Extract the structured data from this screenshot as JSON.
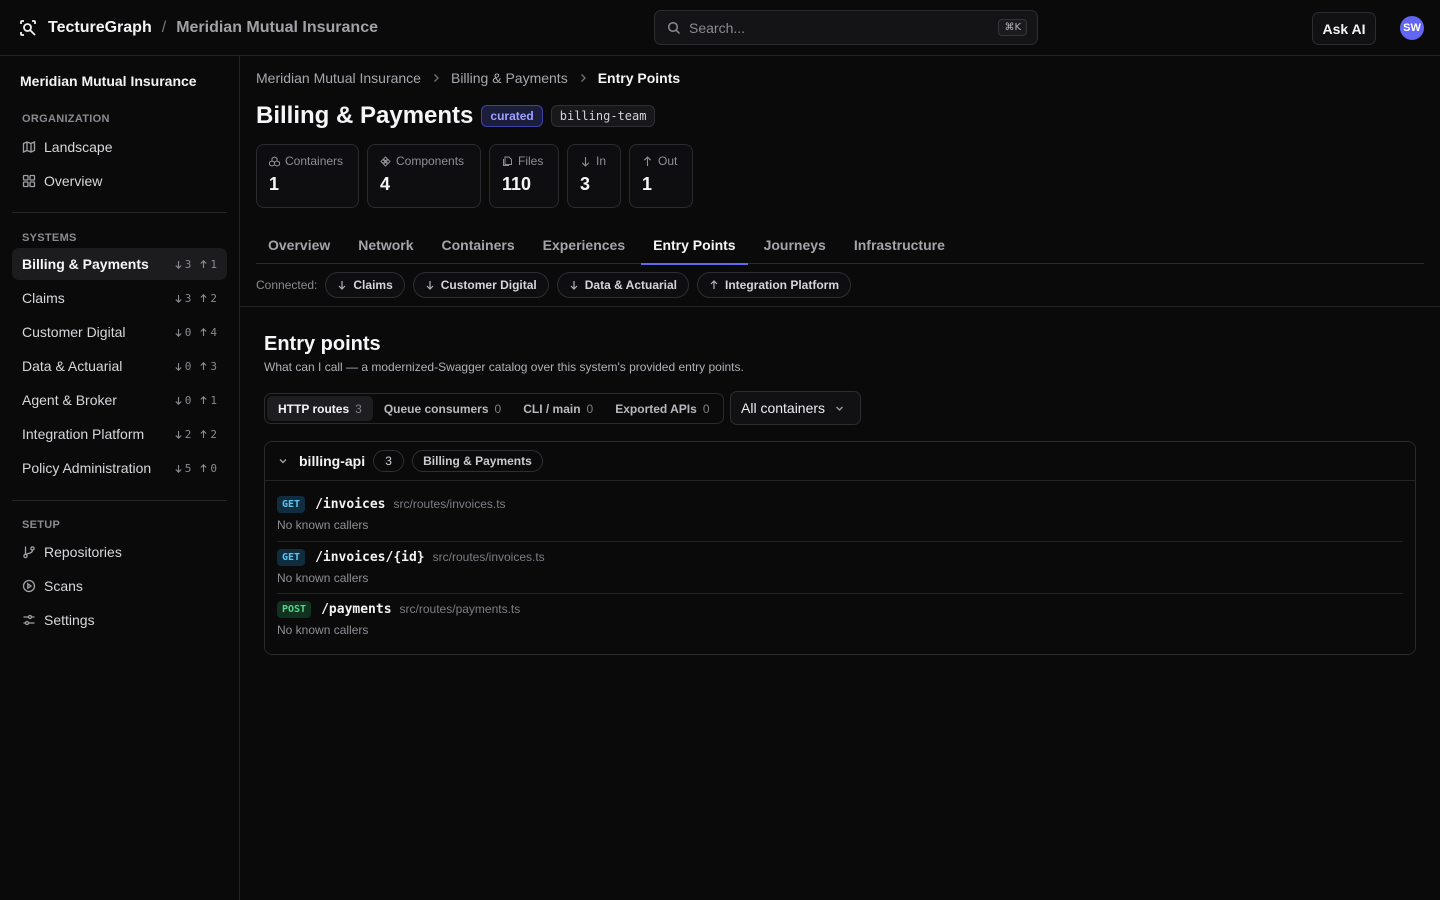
{
  "app": {
    "brand": "TectureGraph",
    "separator": "/",
    "org": "Meridian Mutual Insurance",
    "search_placeholder": "Search...",
    "search_shortcut": "⌘K",
    "ask_ai": "Ask AI",
    "avatar_initials": "SW",
    "accent_color": "#6366f1"
  },
  "sidebar": {
    "org_name": "Meridian Mutual Insurance",
    "organization_label": "ORGANIZATION",
    "organization_items": [
      {
        "label": "Landscape",
        "icon": "map-icon"
      },
      {
        "label": "Overview",
        "icon": "grid-icon"
      }
    ],
    "systems_label": "SYSTEMS",
    "systems": [
      {
        "label": "Billing & Payments",
        "in": "3",
        "out": "1",
        "active": true
      },
      {
        "label": "Claims",
        "in": "3",
        "out": "2"
      },
      {
        "label": "Customer Digital",
        "in": "0",
        "out": "4"
      },
      {
        "label": "Data & Actuarial",
        "in": "0",
        "out": "3"
      },
      {
        "label": "Agent & Broker",
        "in": "0",
        "out": "1"
      },
      {
        "label": "Integration Platform",
        "in": "2",
        "out": "2"
      },
      {
        "label": "Policy Administration",
        "in": "5",
        "out": "0"
      }
    ],
    "setup_label": "SETUP",
    "setup_items": [
      {
        "label": "Repositories",
        "icon": "git-branch-icon"
      },
      {
        "label": "Scans",
        "icon": "play-circle-icon"
      },
      {
        "label": "Settings",
        "icon": "sliders-icon"
      }
    ]
  },
  "breadcrumb": [
    "Meridian Mutual Insurance",
    "Billing & Payments",
    "Entry Points"
  ],
  "page": {
    "title": "Billing & Payments",
    "badge_curated": "curated",
    "badge_team": "billing-team"
  },
  "stats": [
    {
      "label": "Containers",
      "value": "1",
      "icon": "boxes-icon"
    },
    {
      "label": "Components",
      "value": "4",
      "icon": "component-icon"
    },
    {
      "label": "Files",
      "value": "110",
      "icon": "files-icon"
    },
    {
      "label": "In",
      "value": "3",
      "icon": "arrow-down-icon"
    },
    {
      "label": "Out",
      "value": "1",
      "icon": "arrow-up-icon"
    }
  ],
  "tabs": [
    {
      "label": "Overview"
    },
    {
      "label": "Network"
    },
    {
      "label": "Containers"
    },
    {
      "label": "Experiences"
    },
    {
      "label": "Entry Points",
      "active": true
    },
    {
      "label": "Journeys"
    },
    {
      "label": "Infrastructure"
    }
  ],
  "connected": {
    "label": "Connected:",
    "chips": [
      {
        "label": "Claims",
        "direction": "down"
      },
      {
        "label": "Customer Digital",
        "direction": "down"
      },
      {
        "label": "Data & Actuarial",
        "direction": "down"
      },
      {
        "label": "Integration Platform",
        "direction": "up"
      }
    ]
  },
  "entry_points": {
    "title": "Entry points",
    "subtitle": "What can I call — a modernized-Swagger catalog over this system's provided entry points.",
    "kinds": [
      {
        "label": "HTTP routes",
        "count": "3",
        "active": true
      },
      {
        "label": "Queue consumers",
        "count": "0"
      },
      {
        "label": "CLI / main",
        "count": "0"
      },
      {
        "label": "Exported APIs",
        "count": "0"
      }
    ],
    "container_filter": "All containers",
    "group": {
      "name": "billing-api",
      "count": "3",
      "system": "Billing & Payments",
      "routes": [
        {
          "method": "GET",
          "path": "/invoices",
          "file": "src/routes/invoices.ts",
          "callers": "No known callers"
        },
        {
          "method": "GET",
          "path": "/invoices/{id}",
          "file": "src/routes/invoices.ts",
          "callers": "No known callers"
        },
        {
          "method": "POST",
          "path": "/payments",
          "file": "src/routes/payments.ts",
          "callers": "No known callers"
        }
      ]
    }
  }
}
